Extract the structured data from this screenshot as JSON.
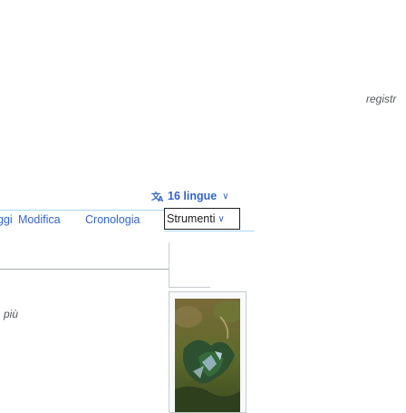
{
  "header": {
    "register_label": "registr"
  },
  "language": {
    "label": "16 lingue",
    "icon": "translate-icon"
  },
  "tabs": {
    "read_partial": "ggi",
    "edit": "Modifica",
    "history": "Cronologia"
  },
  "tools": {
    "label": "Strumenti"
  },
  "sidebar": {
    "more_label": "più"
  },
  "colors": {
    "link": "#3366cc",
    "text": "#202122",
    "muted": "#54595d",
    "border": "#a2a9b1",
    "tab_divider": "#a7d7f9"
  },
  "image": {
    "icon": "photo-image"
  }
}
